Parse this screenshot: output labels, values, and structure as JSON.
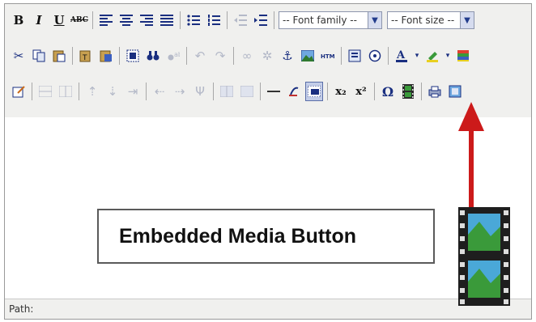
{
  "toolbar": {
    "row1": {
      "bold": "B",
      "italic": "I",
      "underline": "U",
      "strikethrough": "ABC",
      "font_family": "-- Font family --",
      "font_size": "-- Font size --"
    },
    "row3": {
      "subscript": "x₂",
      "superscript": "x²",
      "omega": "Ω"
    }
  },
  "callout": {
    "label": "Embedded Media Button"
  },
  "statusbar": {
    "path_label": "Path:"
  },
  "colors": {
    "icon_blue": "#1a2f80",
    "arrow_red": "#cc1a1a",
    "media_green": "#3a9a3a"
  }
}
